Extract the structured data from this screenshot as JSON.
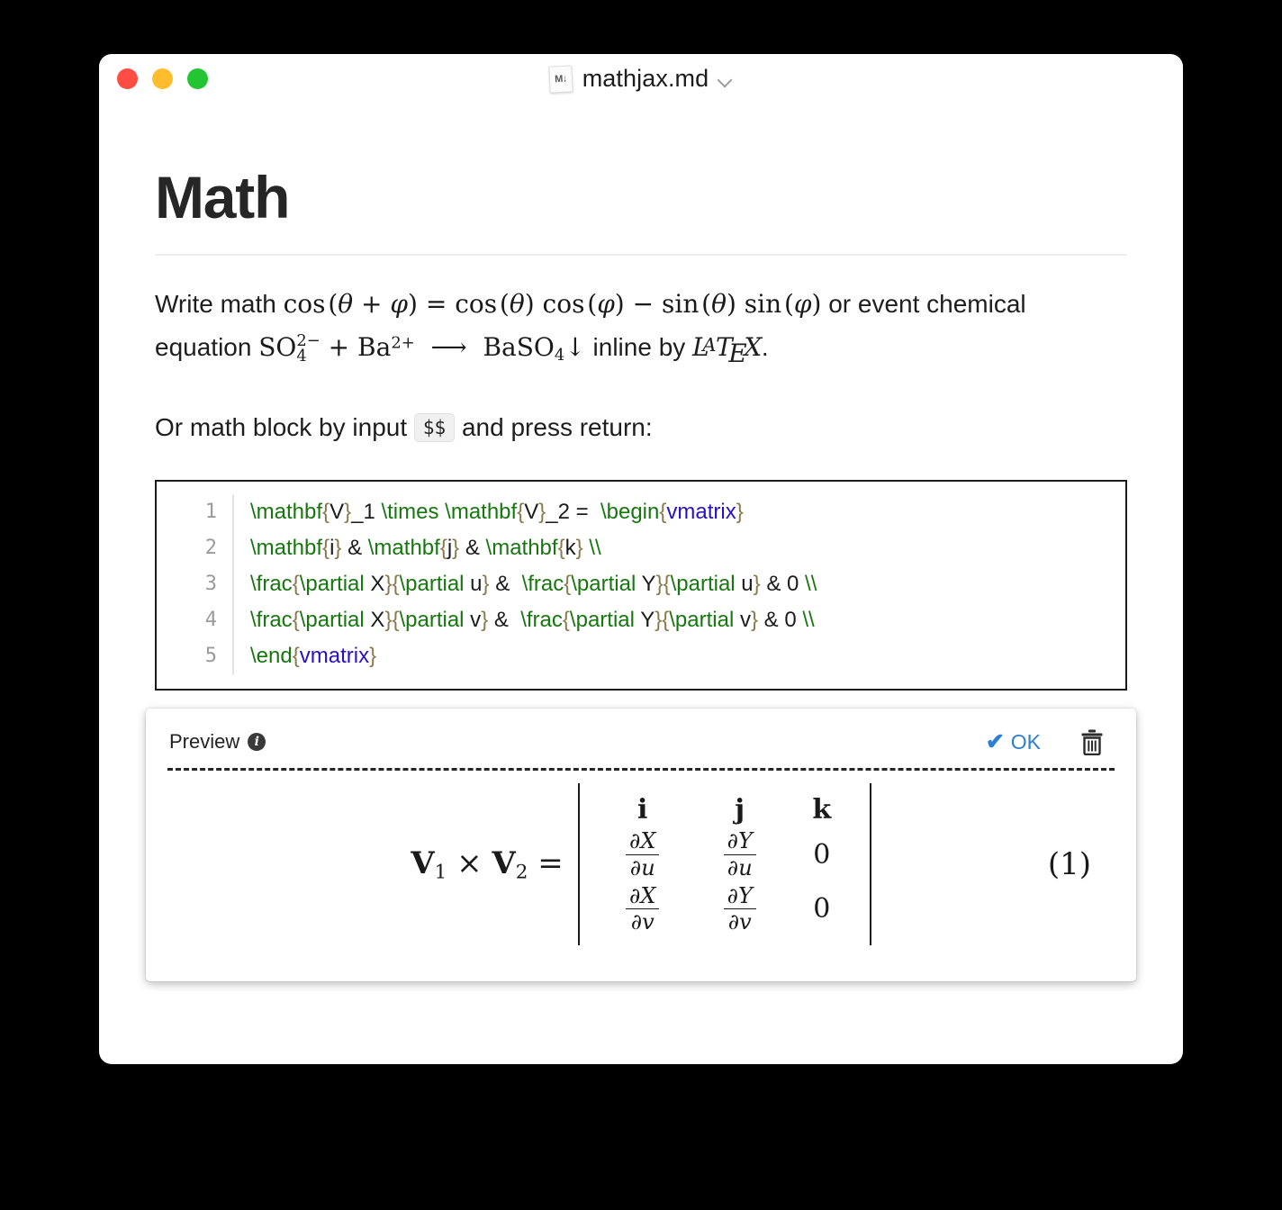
{
  "window": {
    "traffic_lights": [
      {
        "name": "close",
        "color": "#ff4d44"
      },
      {
        "name": "minimize",
        "color": "#ffbd2e"
      },
      {
        "name": "maximize",
        "color": "#23c632"
      }
    ],
    "file_icon_label": "M↓",
    "title": "mathjax.md",
    "chevron": "⌄"
  },
  "doc": {
    "heading": "Math",
    "paragraph1": {
      "lead": "Write math ",
      "math_inline": "cos (θ + φ) = cos (θ) cos (φ) − sin (θ) sin (φ)",
      "mid": " or event chemical equation ",
      "chem_inline": "SO₄²⁻ + Ba²⁺ ⟶ BaSO₄↓",
      "tail_before_logo": " inline by ",
      "latex_logo": "LaTeX",
      "tail": "."
    },
    "paragraph2": {
      "before": "Or math block by input ",
      "kbd": "$$",
      "after": " and press return:"
    }
  },
  "code_block": {
    "line_numbers": [
      "1",
      "2",
      "3",
      "4",
      "5"
    ],
    "lines": [
      "\\mathbf{V}_1 \\times \\mathbf{V}_2 =  \\begin{vmatrix}",
      "\\mathbf{i} & \\mathbf{j} & \\mathbf{k} \\\\",
      "\\frac{\\partial X}{\\partial u} &  \\frac{\\partial Y}{\\partial u} & 0 \\\\",
      "\\frac{\\partial X}{\\partial v} &  \\frac{\\partial Y}{\\partial v} & 0 \\\\",
      "\\end{vmatrix}"
    ],
    "colors": {
      "command": "#17770f",
      "brace": "#8a7b4e",
      "environment": "#2b11c4",
      "text": "#1c1c1c",
      "line_number": "#9b9b9b",
      "border": "#1b1b1b"
    }
  },
  "preview": {
    "label": "Preview",
    "info_icon": "i",
    "ok_label": "OK",
    "ok_check": "✔",
    "ok_color": "#2f7fd0",
    "trash_icon": "trash-can",
    "equation_number": "(1)",
    "rendered": {
      "lhs": "V₁ × V₂ =",
      "lhs_v1": "V",
      "lhs_v1_sub": "1",
      "lhs_times": "×",
      "lhs_v2": "V",
      "lhs_v2_sub": "2",
      "lhs_equals": "=",
      "matrix": [
        [
          "i",
          "j",
          "k"
        ],
        [
          "∂X/∂u",
          "∂Y/∂u",
          "0"
        ],
        [
          "∂X/∂v",
          "∂Y/∂v",
          "0"
        ]
      ],
      "row1": {
        "c1": "i",
        "c2": "j",
        "c3": "k"
      },
      "row2": {
        "c1_num": "∂X",
        "c1_den": "∂u",
        "c2_num": "∂Y",
        "c2_den": "∂u",
        "c3": "0"
      },
      "row3": {
        "c1_num": "∂X",
        "c1_den": "∂v",
        "c2_num": "∂Y",
        "c2_den": "∂v",
        "c3": "0"
      }
    }
  }
}
